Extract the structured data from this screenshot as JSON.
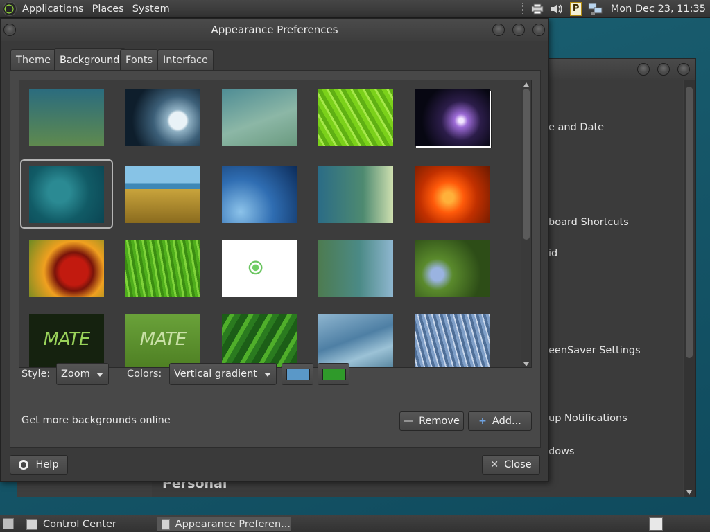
{
  "top_panel": {
    "menus": [
      "Applications",
      "Places",
      "System"
    ],
    "clock": "Mon Dec 23, 11:35",
    "tray_icons": [
      "network-printer-icon",
      "volume-icon",
      "p-badge-icon",
      "network-icon"
    ]
  },
  "control_center": {
    "visible_items": [
      "e and Date",
      "board Shortcuts",
      "id",
      "eenSaver Settings",
      "up Notifications",
      "dows"
    ],
    "section_header": "Personal"
  },
  "appearance": {
    "title": "Appearance Preferences",
    "tabs": [
      "Theme",
      "Background",
      "Fonts",
      "Interface"
    ],
    "active_tab": "Background",
    "style_label": "Style:",
    "style_value": "Zoom",
    "colors_label": "Colors:",
    "colors_value": "Vertical gradient",
    "primary_color": "#5a98c8",
    "secondary_color": "#2f9a2a",
    "online_link": "Get more backgrounds online",
    "remove_label": "Remove",
    "add_label": "Add...",
    "help_label": "Help",
    "close_label": "Close",
    "selected_wallpaper_index": 5,
    "wallpapers": [
      {
        "name": "gradient-teal-olive",
        "text": ""
      },
      {
        "name": "water-drop",
        "text": ""
      },
      {
        "name": "soft-teal-waves",
        "text": ""
      },
      {
        "name": "green-leaf",
        "text": ""
      },
      {
        "name": "comet-space",
        "text": ""
      },
      {
        "name": "teal-smoke",
        "text": ""
      },
      {
        "name": "golden-grass",
        "text": ""
      },
      {
        "name": "blue-bubbles",
        "text": ""
      },
      {
        "name": "teal-dots",
        "text": ""
      },
      {
        "name": "orange-flower",
        "text": ""
      },
      {
        "name": "red-marigold",
        "text": ""
      },
      {
        "name": "green-grass",
        "text": ""
      },
      {
        "name": "mate-logo-white",
        "text": ""
      },
      {
        "name": "teal-green-wave",
        "text": ""
      },
      {
        "name": "ladybug-flowers",
        "text": ""
      },
      {
        "name": "mate-dark",
        "text": "MATE"
      },
      {
        "name": "mate-green",
        "text": "MATE"
      },
      {
        "name": "green-leaves-drops",
        "text": ""
      },
      {
        "name": "blue-curves",
        "text": ""
      },
      {
        "name": "blue-grass-abstract",
        "text": ""
      }
    ]
  },
  "taskbar": {
    "tasks": [
      "Control Center",
      "Appearance Preferen..."
    ],
    "active_task": 1
  }
}
